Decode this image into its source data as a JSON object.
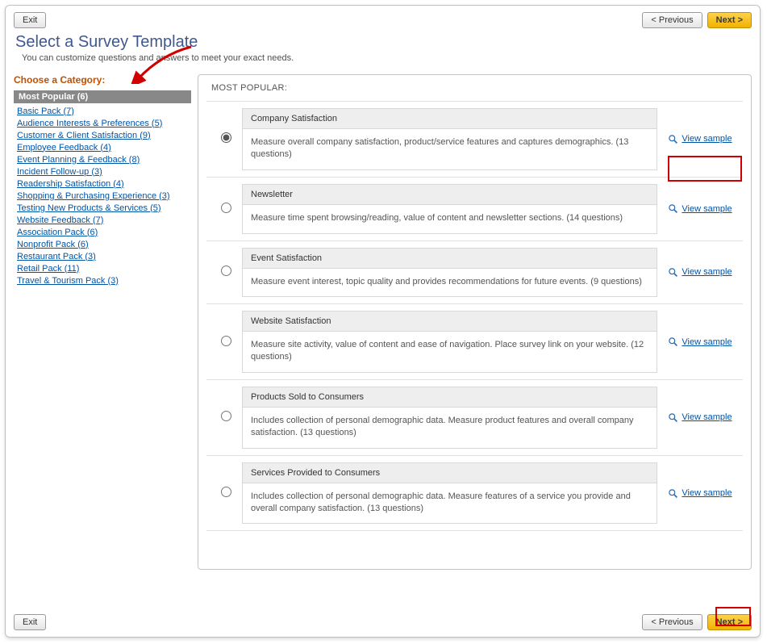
{
  "toolbar": {
    "exit": "Exit",
    "previous": "< Previous",
    "next": "Next >"
  },
  "page": {
    "title": "Select a Survey Template",
    "subtitle": "You can customize questions and answers to meet your exact needs."
  },
  "sidebar": {
    "heading": "Choose a Category:",
    "active": "Most Popular (6)",
    "items": [
      "Basic Pack (7)",
      "Audience Interests & Preferences (5)",
      "Customer & Client Satisfaction (9)",
      "Employee Feedback (4)",
      "Event Planning & Feedback (8)",
      "Incident Follow-up (3)",
      "Readership Satisfaction (4)",
      "Shopping & Purchasing Experience (3)",
      "Testing New Products & Services (5)",
      "Website Feedback (7)",
      "Association Pack (6)",
      "Nonprofit Pack (6)",
      "Restaurant Pack (3)",
      "Retail Pack (11)",
      "Travel & Tourism Pack (3)"
    ]
  },
  "panel": {
    "header": "MOST POPULAR:",
    "view_sample_label": "View sample"
  },
  "templates": [
    {
      "title": "Company Satisfaction",
      "desc": "Measure overall company satisfaction, product/service features and captures demographics. (13 questions)"
    },
    {
      "title": "Newsletter",
      "desc": "Measure time spent browsing/reading, value of content and newsletter sections. (14 questions)"
    },
    {
      "title": "Event Satisfaction",
      "desc": "Measure event interest, topic quality and provides recommendations for future events. (9 questions)"
    },
    {
      "title": "Website Satisfaction",
      "desc": "Measure site activity, value of content and ease of navigation. Place survey link on your website. (12 questions)"
    },
    {
      "title": "Products Sold to Consumers",
      "desc": "Includes collection of personal demographic data. Measure product features and overall company satisfaction. (13 questions)"
    },
    {
      "title": "Services Provided to Consumers",
      "desc": "Includes collection of personal demographic data. Measure features of a service you provide and overall company satisfaction. (13 questions)"
    }
  ]
}
